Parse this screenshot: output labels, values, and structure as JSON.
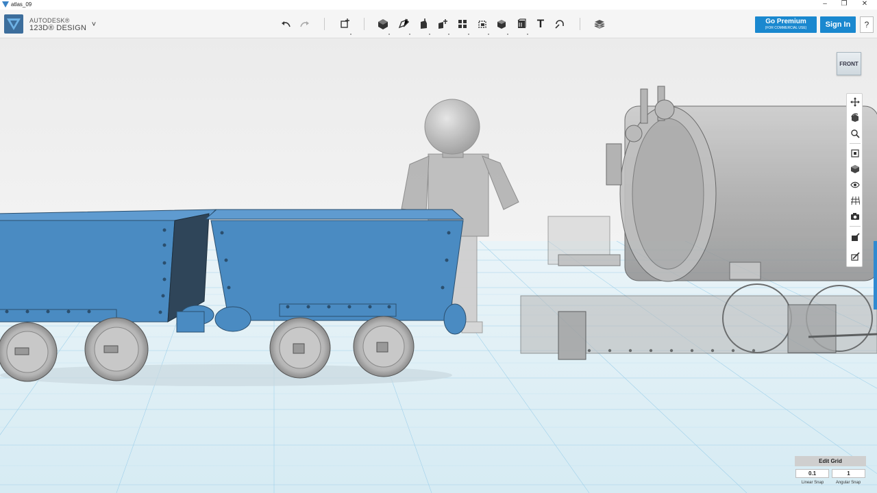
{
  "window": {
    "title": "atlas_09",
    "minimize": "–",
    "restore": "❐",
    "close": "✕"
  },
  "app": {
    "brand_line1": "AUTODESK®",
    "brand_line2": "123D® DESIGN",
    "menu_glyph": "˅"
  },
  "toolbar": {
    "tools": [
      {
        "name": "undo-icon",
        "glyph": "↶"
      },
      {
        "name": "redo-icon",
        "glyph": "↷"
      },
      {
        "name": "transform-icon",
        "glyph": ""
      },
      {
        "name": "primitives-icon",
        "glyph": ""
      },
      {
        "name": "sketch-icon",
        "glyph": ""
      },
      {
        "name": "construct-icon",
        "glyph": ""
      },
      {
        "name": "modify-icon",
        "glyph": ""
      },
      {
        "name": "pattern-icon",
        "glyph": ""
      },
      {
        "name": "grouping-icon",
        "glyph": ""
      },
      {
        "name": "combine-icon",
        "glyph": ""
      },
      {
        "name": "measure-icon",
        "glyph": ""
      },
      {
        "name": "text-icon",
        "glyph": "T"
      },
      {
        "name": "snap-icon",
        "glyph": ""
      },
      {
        "name": "material-icon",
        "glyph": ""
      }
    ]
  },
  "account": {
    "premium_label": "Go Premium",
    "premium_sub": "(FOR COMMERCIAL USE)",
    "signin_label": "Sign In",
    "help_label": "?"
  },
  "viewcube": {
    "face": "FRONT"
  },
  "navbar": {
    "buttons": [
      "pan-icon",
      "orbit-icon",
      "zoom-icon",
      "fit-icon",
      "view-mode-icon",
      "visibility-icon",
      "grid-icon",
      "screenshot-icon",
      "materials-icon",
      "outline-icon"
    ]
  },
  "snap": {
    "edit_grid_label": "Edit Grid",
    "linear_value": "0.1",
    "angular_value": "1",
    "linear_label": "Linear Snap",
    "angular_label": "Angular Snap"
  },
  "colors": {
    "toolbar_bg": "#f5f5f5",
    "accent": "#1a88cf",
    "cart_blue": "#4a8bc2",
    "grid_line": "#8ec8e6",
    "ghost_grey": "#a7a7a7"
  }
}
